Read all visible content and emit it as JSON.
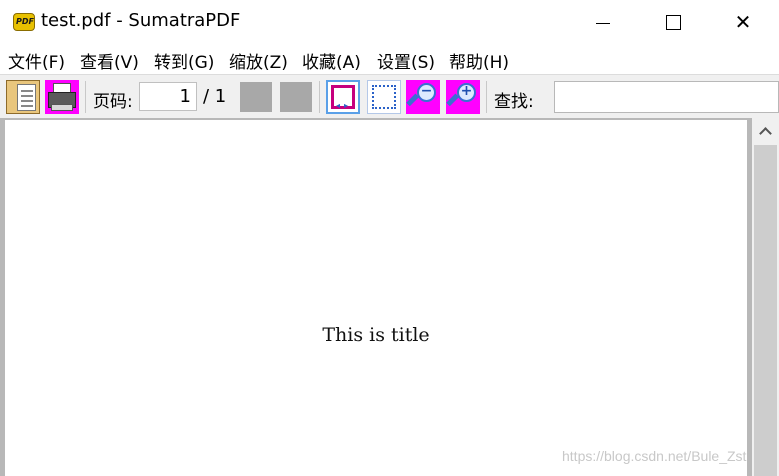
{
  "window": {
    "icon_text": "PDF",
    "title": "test.pdf - SumatraPDF",
    "minimize": "minimize-icon",
    "maximize": "maximize-icon",
    "close": "✕"
  },
  "menu": {
    "file": "文件(F)",
    "view": "查看(V)",
    "goto": "转到(G)",
    "zoom": "缩放(Z)",
    "favorites": "收藏(A)",
    "settings": "设置(S)",
    "help": "帮助(H)"
  },
  "toolbar": {
    "page_label": "页码:",
    "page_value": "1",
    "page_total": "/ 1",
    "find_label": "查找:",
    "find_value": "",
    "icons": [
      "open-icon",
      "print-icon",
      "prev-page-icon",
      "next-page-icon",
      "fit-width-icon",
      "fit-page-icon",
      "zoom-out-icon",
      "zoom-in-icon"
    ]
  },
  "document": {
    "title": "This is title"
  },
  "watermark": "https://blog.csdn.net/Bule_Zst",
  "colors": {
    "icon_bg": "#ff00ff",
    "accent": "#5aa0e8",
    "doc_border": "#b8b8b8"
  }
}
